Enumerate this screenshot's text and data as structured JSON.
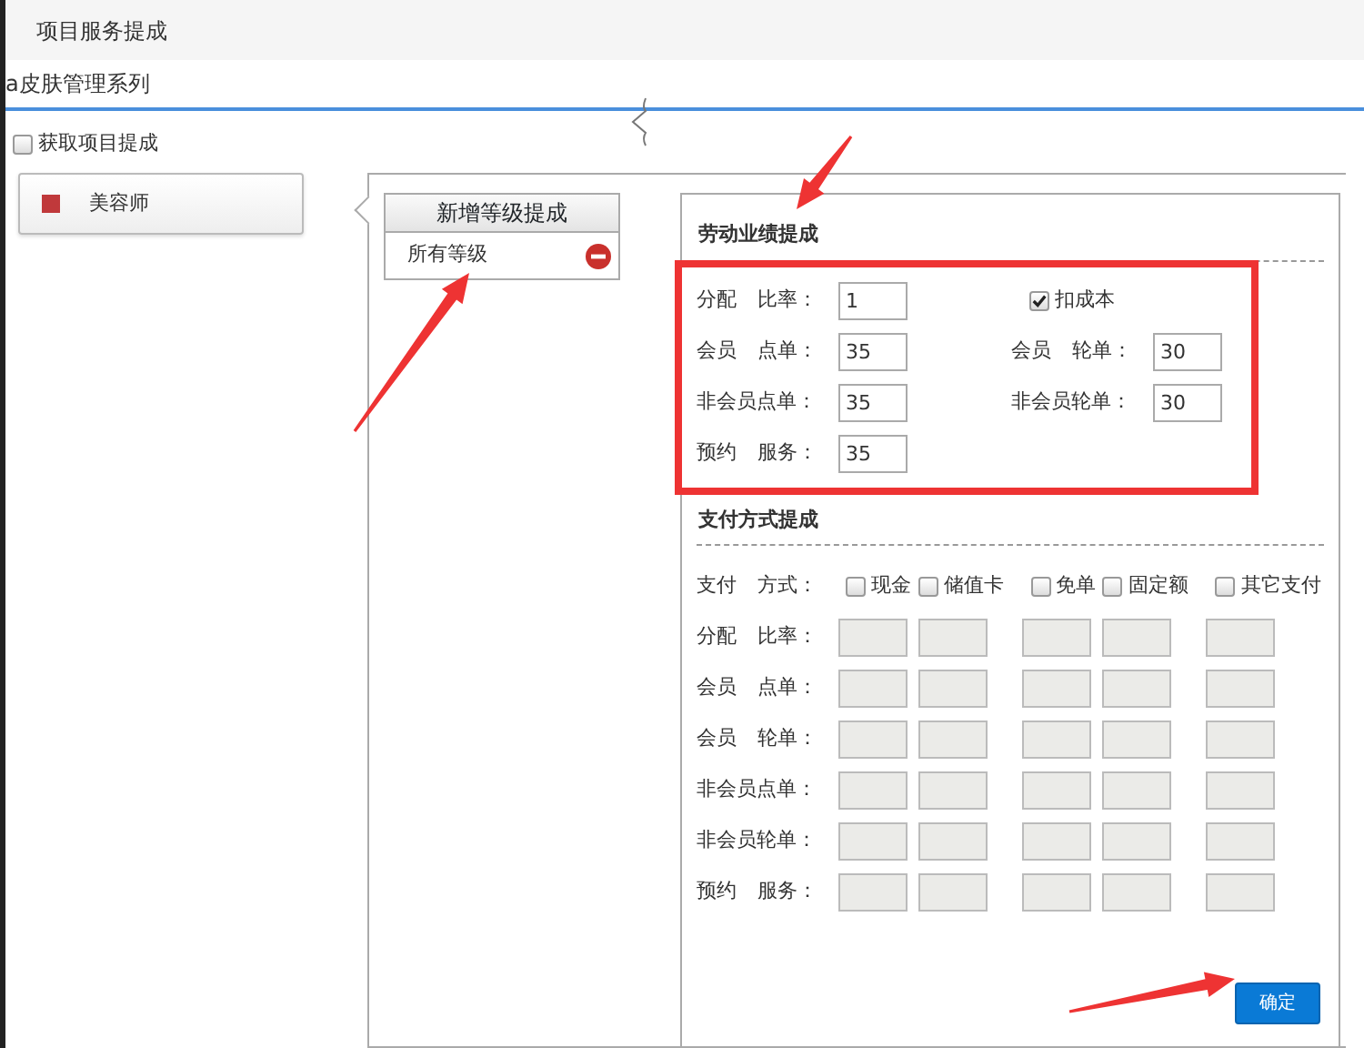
{
  "header": {
    "title": "项目服务提成"
  },
  "series_title": "a皮肤管理系列",
  "fetch_option": {
    "label": "获取项目提成",
    "checked": false
  },
  "roles": [
    {
      "name": "美容师",
      "selected": true,
      "color": "#c0393b"
    }
  ],
  "level_panel": {
    "add_button": "新增等级提成",
    "levels": [
      {
        "name": "所有等级",
        "selected": false
      }
    ]
  },
  "labor_section": {
    "title": "劳动业绩提成",
    "rows": [
      {
        "cells": [
          {
            "kind": "input",
            "label": "分配 比率：",
            "value": "1"
          },
          {
            "kind": "checkbox",
            "label": "扣成本",
            "checked": true
          }
        ]
      },
      {
        "cells": [
          {
            "kind": "input",
            "label": "会员 点单：",
            "value": "35"
          },
          {
            "kind": "input",
            "label": "会员 轮单：",
            "value": "30"
          }
        ]
      },
      {
        "cells": [
          {
            "kind": "input",
            "label": "非会员点单：",
            "value": "35"
          },
          {
            "kind": "input",
            "label": "非会员轮单：",
            "value": "30"
          }
        ]
      },
      {
        "cells": [
          {
            "kind": "input",
            "label": "预约 服务：",
            "value": "35"
          }
        ]
      }
    ]
  },
  "payment_section": {
    "title": "支付方式提成",
    "method_label": "支付 方式：",
    "methods": [
      {
        "label": "现金",
        "checked": false
      },
      {
        "label": "储值卡",
        "checked": false
      },
      {
        "label": "免单",
        "checked": false
      },
      {
        "label": "固定额",
        "checked": false
      },
      {
        "label": "其它支付",
        "checked": false
      }
    ],
    "rows": [
      {
        "label": "分配 比率：",
        "disabled": true
      },
      {
        "label": "会员 点单：",
        "disabled": true
      },
      {
        "label": "会员 轮单：",
        "disabled": true
      },
      {
        "label": "非会员点单：",
        "disabled": true
      },
      {
        "label": "非会员轮单：",
        "disabled": true
      },
      {
        "label": "预约 服务：",
        "disabled": true
      }
    ]
  },
  "confirm_button": "确定"
}
